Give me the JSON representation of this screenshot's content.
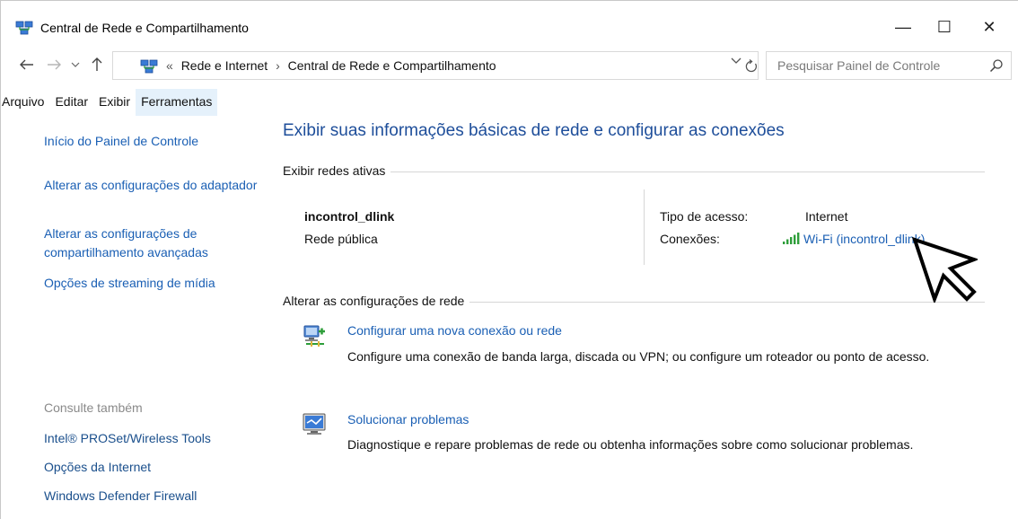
{
  "window": {
    "title": "Central de Rede e Compartilhamento",
    "controls": {
      "minimize": "—",
      "maximize": "☐",
      "close": "✕"
    }
  },
  "address": {
    "prefix": "«",
    "breadcrumb": [
      "Rede e Internet",
      "Central de Rede e Compartilhamento"
    ],
    "separator": "›",
    "search_placeholder": "Pesquisar Painel de Controle"
  },
  "menu": [
    "Arquivo",
    "Editar",
    "Exibir",
    "Ferramentas"
  ],
  "sidebar": {
    "links": [
      "Início do Painel de Controle",
      "Alterar as configurações do adaptador",
      "Alterar as configurações de compartilhamento avançadas",
      "Opções de streaming de mídia"
    ],
    "see_also_heading": "Consulte também",
    "see_also": [
      "Intel® PROSet/Wireless Tools",
      "Opções da Internet",
      "Windows Defender Firewall"
    ]
  },
  "main": {
    "title": "Exibir suas informações básicas de rede e configurar as conexões",
    "active_networks_label": "Exibir redes ativas",
    "network": {
      "name": "incontrol_dlink",
      "category": "Rede pública",
      "access_type_label": "Tipo de acesso:",
      "access_type_value": "Internet",
      "connections_label": "Conexões:",
      "connections_value": "Wi-Fi (incontrol_dlink)"
    },
    "change_settings_label": "Alterar as configurações de rede",
    "tasks": [
      {
        "title": "Configurar uma nova conexão ou rede",
        "description": "Configure uma conexão de banda larga, discada ou VPN; ou configure um roteador ou ponto de acesso.",
        "icon": "network-setup-icon"
      },
      {
        "title": "Solucionar problemas",
        "description": "Diagnostique e repare problemas de rede ou obtenha informações sobre como solucionar problemas.",
        "icon": "troubleshoot-icon"
      }
    ]
  },
  "colors": {
    "link": "#1a5fb4",
    "title": "#1e4e9a",
    "signal": "#2e9e3a"
  }
}
